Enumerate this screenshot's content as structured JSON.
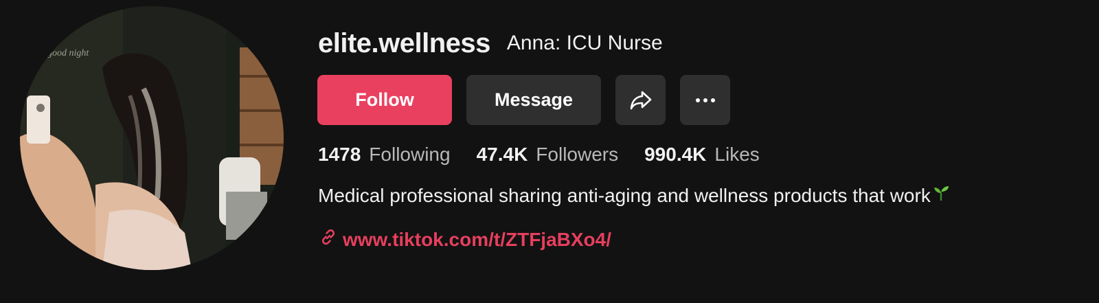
{
  "profile": {
    "username": "elite.wellness",
    "nickname": "Anna: ICU Nurse",
    "avatar_icon": "profile-photo"
  },
  "actions": {
    "follow_label": "Follow",
    "message_label": "Message",
    "share_icon": "share-arrow-icon",
    "more_icon": "more-dots-icon"
  },
  "stats": {
    "following_count": "1478",
    "following_label": "Following",
    "followers_count": "47.4K",
    "followers_label": "Followers",
    "likes_count": "990.4K",
    "likes_label": "Likes"
  },
  "bio": {
    "text": "Medical professional sharing anti-aging and wellness products that work",
    "emoji_icon": "seedling-icon"
  },
  "link": {
    "icon": "link-icon",
    "url": "www.tiktok.com/t/ZTFjaBXo4/"
  },
  "colors": {
    "background": "#121212",
    "follow_button": "#ea4060",
    "secondary_button": "#2f2f2f",
    "link": "#e63f5e"
  }
}
